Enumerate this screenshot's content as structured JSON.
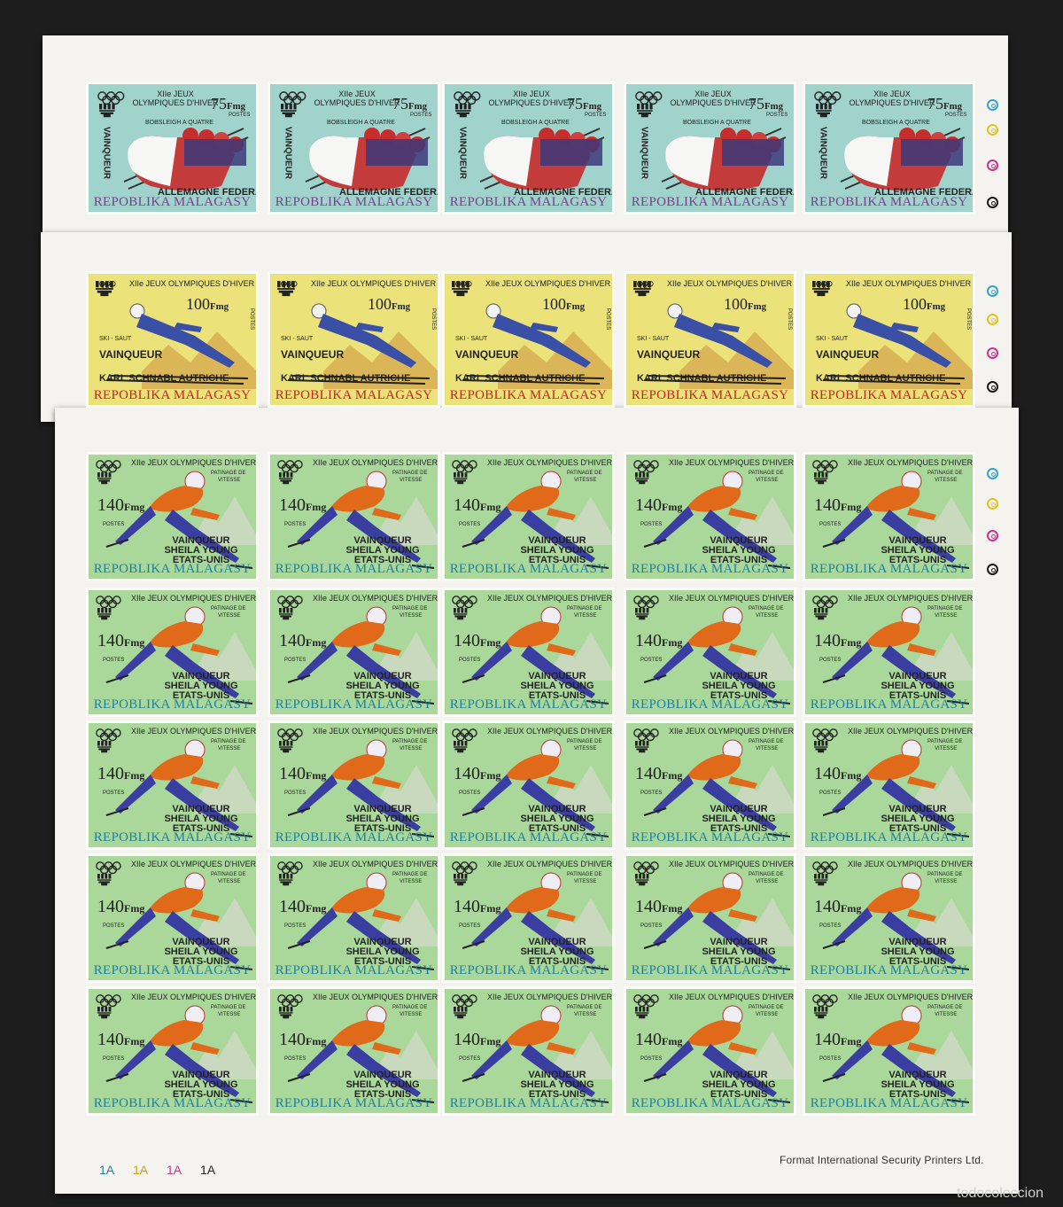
{
  "sheets": {
    "bobsleigh": {
      "title": "XIIe JEUX OLYMPIQUES D'HIVER",
      "value": "75",
      "currency": "Fmg",
      "postes": "POSTES",
      "event": "BOBSLEIGH A QUATRE",
      "vainqueur": "VAINQUEUR",
      "winner": "ALLEMAGNE FEDERALE",
      "country": "REPOBLIKA MALAGASY",
      "bg_color": "#9fd3cc",
      "country_color": "#7a3d8c"
    },
    "ski": {
      "title": "XIIe JEUX OLYMPIQUES D'HIVER",
      "value": "100",
      "currency": "Fmg",
      "postes": "POSTES",
      "event": "SKI - SAUT",
      "vainqueur": "VAINQUEUR",
      "winner": "KARL SCHNABL AUTRICHE",
      "country": "REPOBLIKA MALAGASY",
      "bg_color": "#ece27a",
      "country_color": "#c4261f"
    },
    "skating": {
      "title": "XIIe JEUX OLYMPIQUES D'HIVER",
      "value": "140",
      "currency": "Fmg",
      "postes": "POSTES",
      "event_line1": "PATINAGE DE",
      "event_line2": "VITESSE",
      "vainqueur": "VAINQUEUR",
      "winner_line1": "SHEILA YOUNG",
      "winner_line2": "ETATS-UNIS",
      "country": "REPOBLIKA MALAGASY",
      "bg_color": "#a9d89a",
      "country_color": "#1f7fa0"
    }
  },
  "margin": {
    "printer": "Format International Security Printers Ltd.",
    "plate_numbers": [
      "1A",
      "1A",
      "1A",
      "1A"
    ],
    "plate_colors": [
      "#1f7fa0",
      "#d9b21a",
      "#c2378a",
      "#222222"
    ]
  },
  "registration_colors": [
    "#2fa7c9",
    "#e6c21c",
    "#cf2d8f",
    "#1a1a1a"
  ],
  "watermark": "todocoleccion"
}
